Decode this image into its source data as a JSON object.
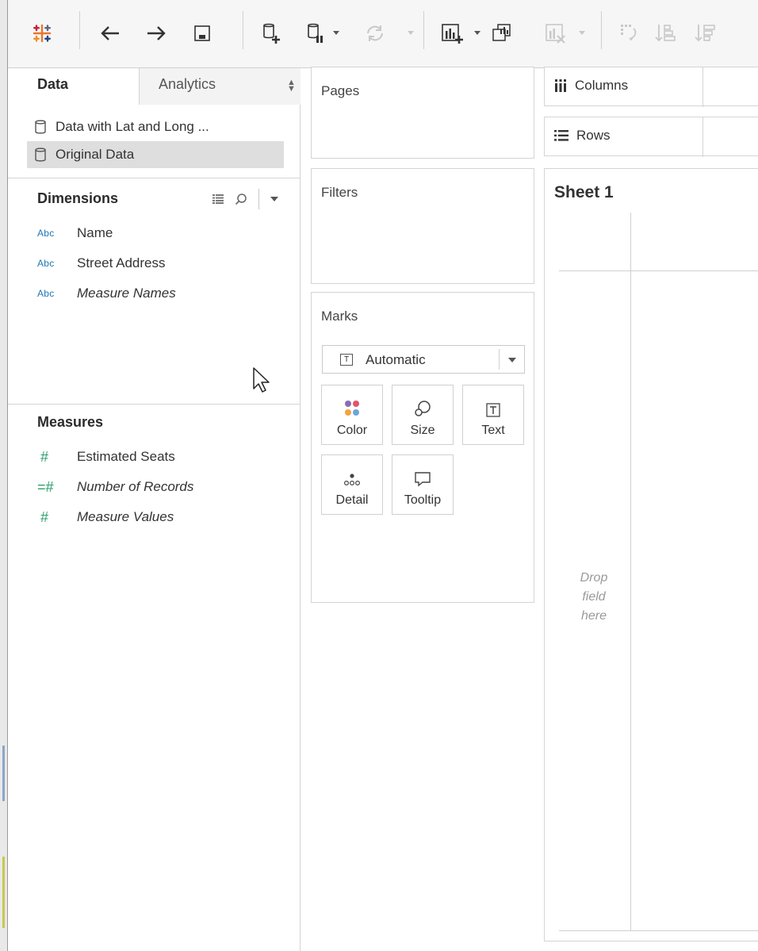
{
  "toolbar": {
    "buttons": [
      "tableau-logo-icon",
      "back-arrow-icon",
      "forward-arrow-icon",
      "save-icon",
      "new-datasource-icon",
      "pause-updates-icon",
      "refresh-icon",
      "new-worksheet-icon",
      "duplicate-sheet-icon",
      "clear-sheet-icon",
      "swap-icon",
      "sort-ascending-icon",
      "sort-descending-icon"
    ]
  },
  "left_pane": {
    "tabs": {
      "data": "Data",
      "analytics": "Analytics"
    },
    "data_sources": [
      {
        "label": "Data with Lat and Long ...",
        "selected": false
      },
      {
        "label": "Original Data",
        "selected": true
      }
    ],
    "dimensions": {
      "title": "Dimensions",
      "fields": [
        {
          "type": "Abc",
          "label": "Name",
          "italic": false
        },
        {
          "type": "Abc",
          "label": "Street Address",
          "italic": false
        },
        {
          "type": "Abc",
          "label": "Measure Names",
          "italic": true
        }
      ]
    },
    "measures": {
      "title": "Measures",
      "fields": [
        {
          "type": "#",
          "label": "Estimated Seats",
          "italic": false
        },
        {
          "type": "=#",
          "label": "Number of Records",
          "italic": true
        },
        {
          "type": "#",
          "label": "Measure Values",
          "italic": true
        }
      ]
    }
  },
  "cards": {
    "pages": "Pages",
    "filters": "Filters",
    "marks": {
      "title": "Marks",
      "mark_type": "Automatic",
      "buttons": {
        "color": "Color",
        "size": "Size",
        "text": "Text",
        "detail": "Detail",
        "tooltip": "Tooltip"
      }
    }
  },
  "shelves": {
    "columns": "Columns",
    "rows": "Rows"
  },
  "sheet": {
    "title": "Sheet 1",
    "drop_hint": [
      "Drop",
      "field",
      "here"
    ]
  },
  "colors": {
    "dimension_type": "#1f77b4",
    "measure_type": "#2e9e6e",
    "selected_row": "#dedede"
  }
}
